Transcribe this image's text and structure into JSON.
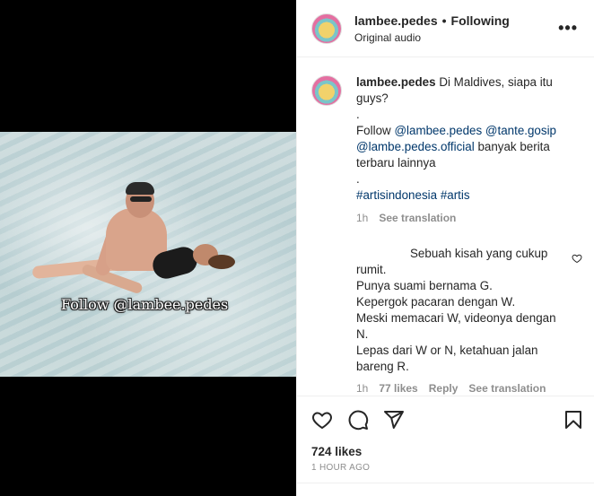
{
  "post": {
    "username": "lambee.pedes",
    "dot": "•",
    "follow_state": "Following",
    "audio": "Original audio",
    "more": "•••",
    "watermark": "Follow @lambee.pedes",
    "avatar_text": "LAMBE PEDES"
  },
  "caption": {
    "username": "lambee.pedes",
    "line1": "Di Maldives, siapa itu guys?",
    "dot1": ".",
    "follow_word": "Follow",
    "mention1": "@lambee.pedes",
    "mention2": "@tante.gosip",
    "mention3": "@lambe.pedes.official",
    "rest": "banyak berita terbaru lainnya",
    "dot2": ".",
    "hashtag1": "#artisindonesia",
    "hashtag2": "#artis",
    "time": "1h",
    "translate": "See translation"
  },
  "comment": {
    "text": "Sebuah kisah yang cukup rumit.",
    "line2": "Punya suami bernama G.",
    "line3": "Kepergok pacaran dengan W.",
    "line4": "Meski memacari W, videonya dengan N.",
    "line5": "Lepas dari W or N, ketahuan jalan bareng R.",
    "time": "1h",
    "likes": "77 likes",
    "reply": "Reply",
    "translate": "See translation"
  },
  "stats": {
    "likes": "724 likes",
    "time_ago": "1 HOUR AGO"
  },
  "icons": [
    "heart-icon",
    "comment-icon",
    "share-icon",
    "bookmark-icon",
    "more-icon"
  ]
}
